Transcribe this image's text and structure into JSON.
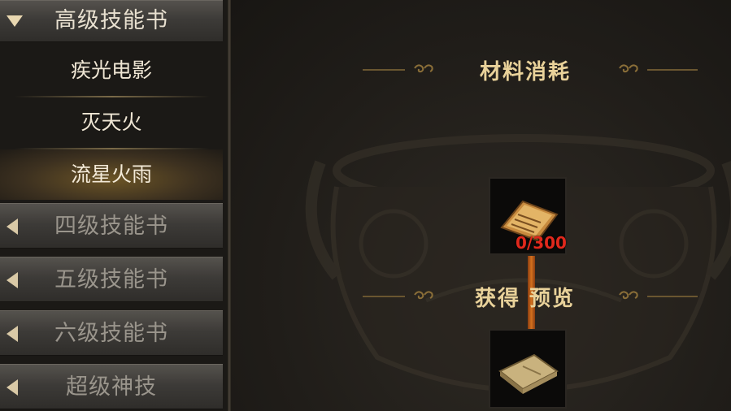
{
  "sidebar": {
    "open_category": "高级技能书",
    "sub_items": [
      "疾光电影",
      "灭天火",
      "流星火雨"
    ],
    "selected_sub_item": "流星火雨",
    "categories": [
      "四级技能书",
      "五级技能书",
      "六级技能书",
      "超级神技"
    ]
  },
  "panel": {
    "materials_title": "材料消耗",
    "material_count": "0/300",
    "preview_title": "获得 预览"
  },
  "icons": {
    "expand": "chevron-down-icon",
    "collapse": "chevron-left-icon",
    "material": "scroll-icon",
    "reward": "skill-book-icon"
  },
  "colors": {
    "accent_gold": "#e9d29a",
    "count_red": "#e0281c",
    "connector_orange": "#d2701e"
  }
}
